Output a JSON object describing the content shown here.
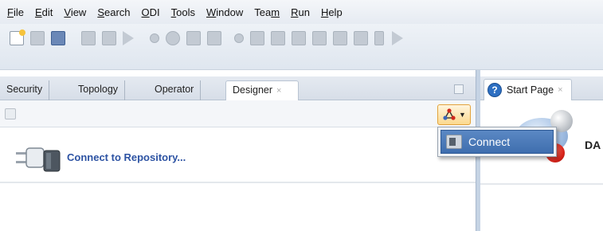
{
  "menubar": {
    "items": [
      {
        "label": "File",
        "mnemonic": "F"
      },
      {
        "label": "Edit",
        "mnemonic": "E"
      },
      {
        "label": "View",
        "mnemonic": "V"
      },
      {
        "label": "Search",
        "mnemonic": "S"
      },
      {
        "label": "ODI",
        "mnemonic": "O"
      },
      {
        "label": "Tools",
        "mnemonic": "T"
      },
      {
        "label": "Window",
        "mnemonic": "W"
      },
      {
        "label": "Team",
        "mnemonic": "m"
      },
      {
        "label": "Run",
        "mnemonic": "R"
      },
      {
        "label": "Help",
        "mnemonic": "H"
      }
    ]
  },
  "navigator": {
    "tabs": [
      {
        "label": "Security"
      },
      {
        "label": "Topology"
      },
      {
        "label": "Operator"
      },
      {
        "label": "Designer",
        "close": "×"
      }
    ],
    "connect_link": "Connect to Repository..."
  },
  "dropdown": {
    "items": [
      {
        "label": "Connect"
      }
    ]
  },
  "start_page": {
    "tab_label": "Start Page",
    "tab_close": "×",
    "title": "DA"
  },
  "colors": {
    "link": "#2d53a3",
    "menu_highlight": "#3f6eae",
    "accent_button": "#fbd98f"
  }
}
